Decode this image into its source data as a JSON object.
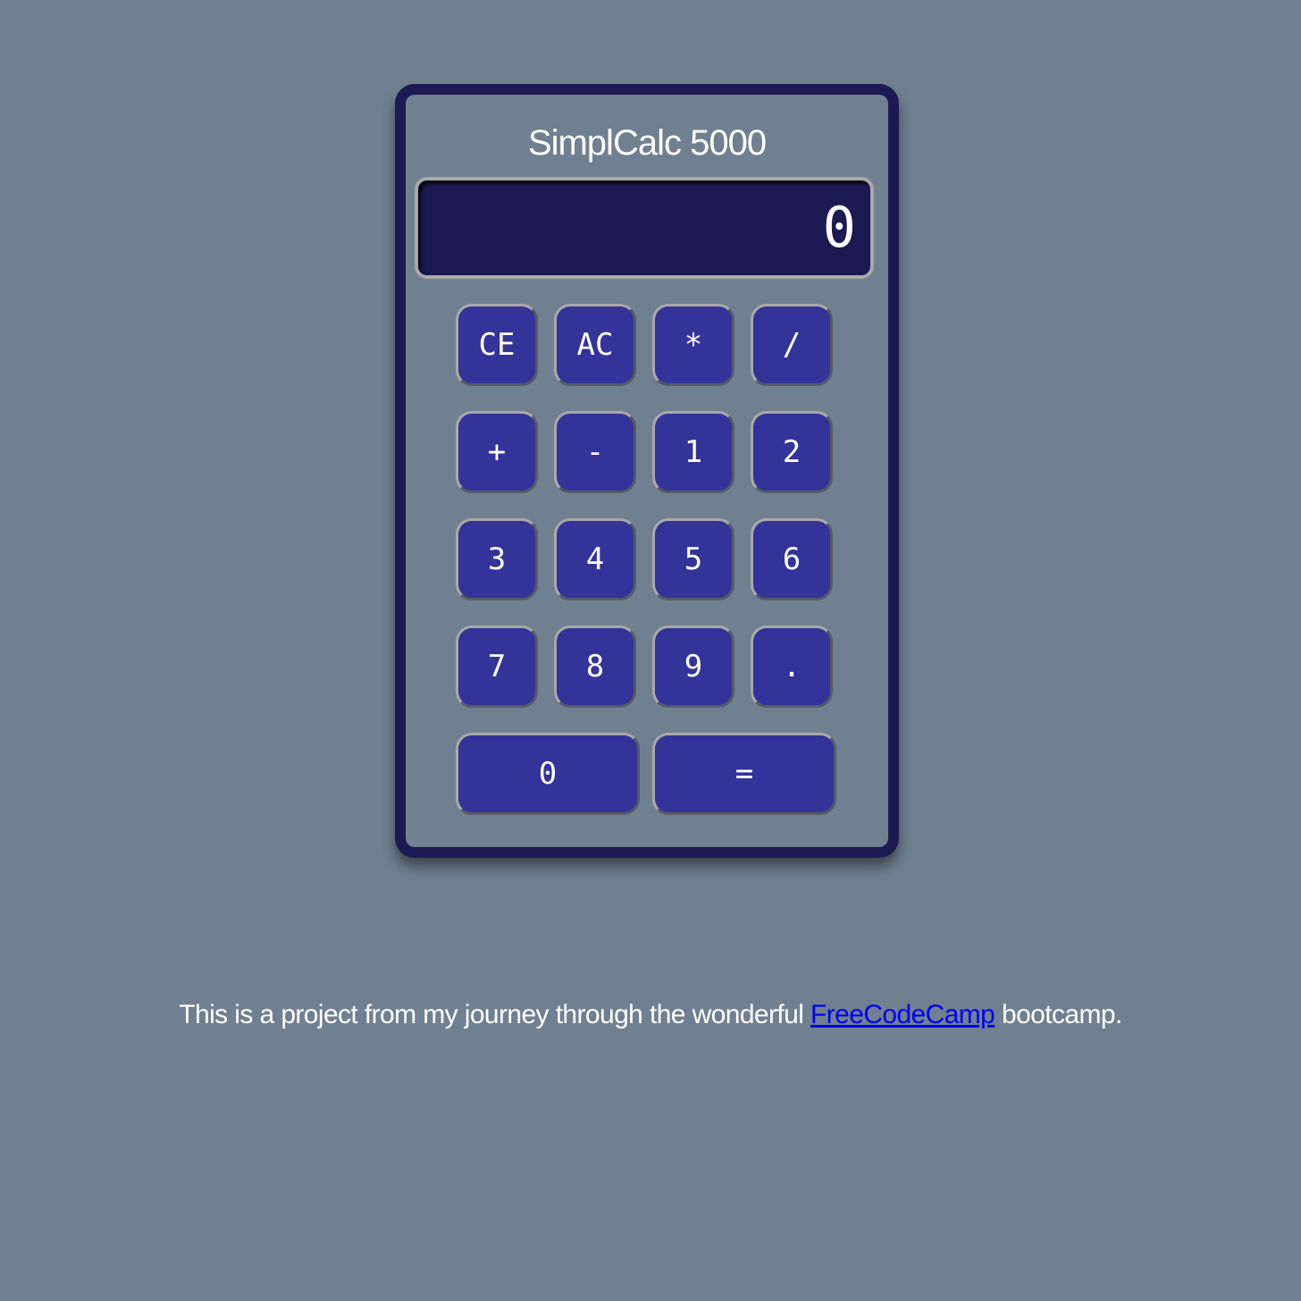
{
  "app": {
    "title": "SimplCalc 5000"
  },
  "display": {
    "value": "0"
  },
  "keys": {
    "ce": "CE",
    "ac": "AC",
    "multiply": "*",
    "divide": "/",
    "plus": "+",
    "minus": "-",
    "one": "1",
    "two": "2",
    "three": "3",
    "four": "4",
    "five": "5",
    "six": "6",
    "seven": "7",
    "eight": "8",
    "nine": "9",
    "decimal": ".",
    "zero": "0",
    "equals": "="
  },
  "footer": {
    "text_before": "This is a project from my journey through the wonderful ",
    "link_text": "FreeCodeCamp",
    "text_after": " bootcamp."
  },
  "colors": {
    "page_background": "#708090",
    "calculator_frame": "#1b1a52",
    "display_background": "#1b1a52",
    "key_background": "#333399",
    "key_border": "#a9a9a9",
    "link": "#0000ee"
  }
}
